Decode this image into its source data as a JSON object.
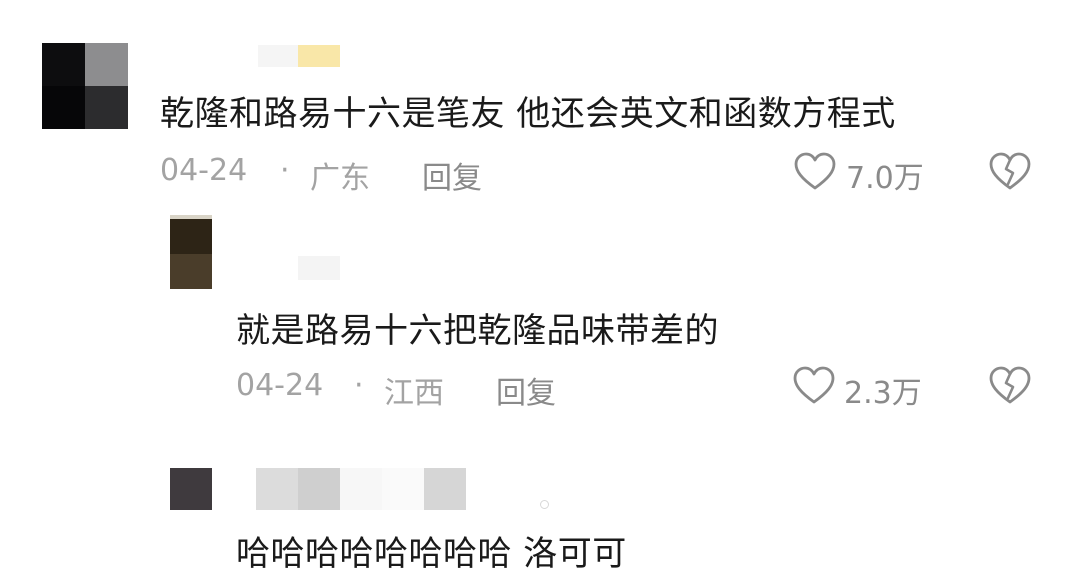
{
  "comments": [
    {
      "text": "乾隆和路易十六是笔友 他还会英文和函数方程式",
      "date": "04-24",
      "separator": "·",
      "location": "广东",
      "reply_label": "回复",
      "likes": "7.0万"
    },
    {
      "text": "就是路易十六把乾隆品味带差的",
      "date": "04-24",
      "separator": "·",
      "location": "江西",
      "reply_label": "回复",
      "likes": "2.3万"
    },
    {
      "text": "哈哈哈哈哈哈哈哈 洛可可"
    }
  ],
  "icons": {
    "like": "heart-outline-icon",
    "dislike": "broken-heart-icon"
  }
}
